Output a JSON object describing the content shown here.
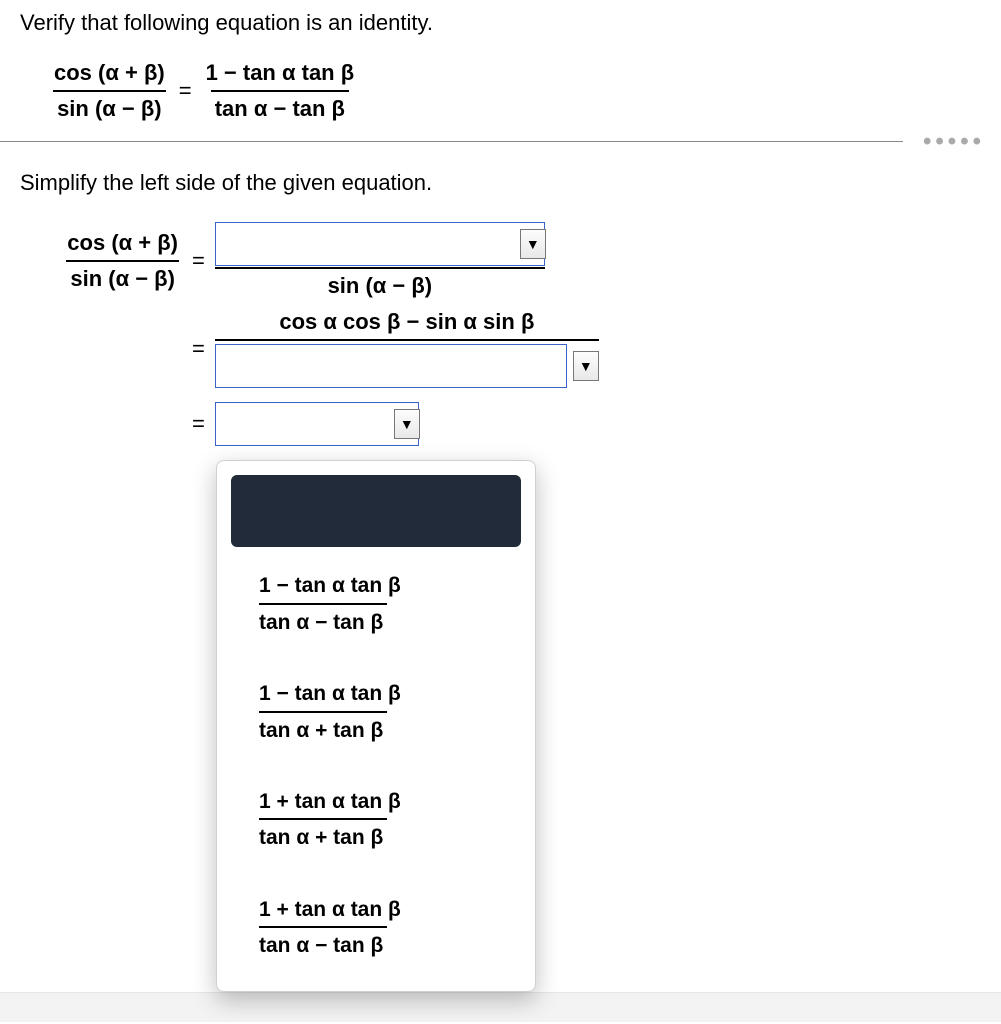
{
  "prompt": "Verify that following equation is an identity.",
  "main_equation": {
    "lhs_num": "cos (α + β)",
    "lhs_den": "sin (α − β)",
    "eq": "=",
    "rhs_num": "1 −  tan α tan β",
    "rhs_den": "tan α −  tan β"
  },
  "instruction": "Simplify the left side of the given equation.",
  "step1": {
    "lhs_num": "cos (α + β)",
    "lhs_den": "sin (α − β)",
    "eq": "=",
    "rhs_num_placeholder": "",
    "rhs_den": "sin (α − β)"
  },
  "step2": {
    "eq": "=",
    "num": "cos α cos β −  sin α sin β",
    "den_placeholder": ""
  },
  "step3": {
    "eq": "=",
    "placeholder": ""
  },
  "dropdown_options": [
    {
      "num": "1 −  tan α tan β",
      "den": "tan α −  tan β"
    },
    {
      "num": "1 −  tan α tan β",
      "den": "tan α +  tan β"
    },
    {
      "num": "1 +  tan α tan β",
      "den": "tan α +  tan β"
    },
    {
      "num": "1 +  tan α tan β",
      "den": "tan α −  tan β"
    }
  ],
  "icons": {
    "chevron_down": "▼",
    "dots": "•••••"
  }
}
